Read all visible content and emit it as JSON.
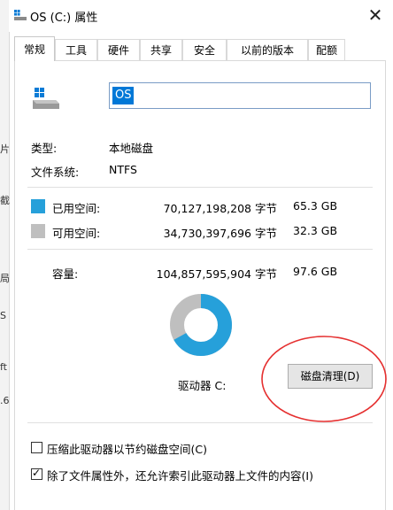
{
  "window": {
    "title": "OS (C:) 属性",
    "close_glyph": "✕"
  },
  "background_fragments": [
    "片",
    "截",
    "局",
    "S",
    "ft",
    ".6"
  ],
  "tabs": [
    {
      "label": "常规",
      "active": true
    },
    {
      "label": "工具",
      "active": false
    },
    {
      "label": "硬件",
      "active": false
    },
    {
      "label": "共享",
      "active": false
    },
    {
      "label": "安全",
      "active": false
    },
    {
      "label": "以前的版本",
      "active": false
    },
    {
      "label": "配额",
      "active": false
    }
  ],
  "drive": {
    "name_value": "OS",
    "type_label": "类型:",
    "type_value": "本地磁盘",
    "fs_label": "文件系统:",
    "fs_value": "NTFS"
  },
  "usage": {
    "used": {
      "label": "已用空间:",
      "bytes": "70,127,198,208 字节",
      "size": "65.3 GB",
      "color": "#26a0da"
    },
    "free": {
      "label": "可用空间:",
      "bytes": "34,730,397,696 字节",
      "size": "32.3 GB",
      "color": "#bfbfbf"
    },
    "capacity": {
      "label": "容量:",
      "bytes": "104,857,595,904 字节",
      "size": "97.6 GB"
    },
    "used_fraction": 0.669
  },
  "drive_label": "驱动器 C:",
  "cleanup_button": "磁盘清理(D)",
  "options": {
    "compress": {
      "label": "压缩此驱动器以节约磁盘空间(C)",
      "checked": false
    },
    "index": {
      "label": "除了文件属性外，还允许索引此驱动器上文件的内容(I)",
      "checked": true
    }
  },
  "annotation_color": "#e53030"
}
